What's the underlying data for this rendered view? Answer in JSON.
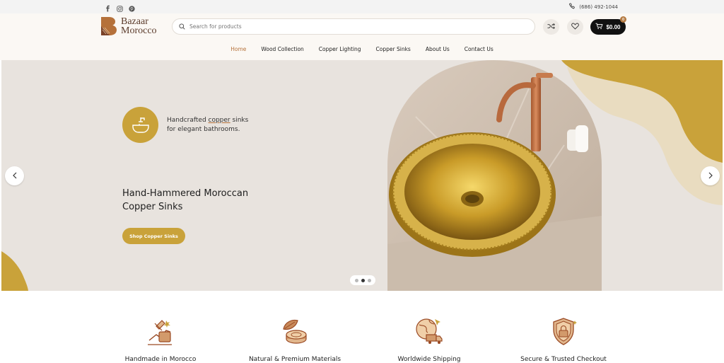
{
  "topbar": {
    "social": [
      "facebook-icon",
      "instagram-icon",
      "pinterest-icon"
    ],
    "phone": "(686) 492-1044"
  },
  "header": {
    "logo_line1": "Bazaar",
    "logo_line2": "Morocco",
    "search_placeholder": "Search for products",
    "cart_total": "$0.00",
    "cart_count": "0"
  },
  "nav": {
    "items": [
      "Home",
      "Wood Collection",
      "Copper Lighting",
      "Copper Sinks",
      "About Us",
      "Contact Us"
    ],
    "active": "Home"
  },
  "hero": {
    "badge_line1_pre": "Handcrafted ",
    "badge_line1_u": "copper",
    "badge_line1_post": " sinks",
    "badge_line2": "for elegant bathrooms.",
    "headline_line1": "Hand-Hammered Moroccan",
    "headline_line2": "Copper Sinks",
    "cta": "Shop Copper Sinks",
    "slide_active": 2,
    "slide_count": 3
  },
  "features": [
    {
      "label": "Handmade in Morocco",
      "icon": "handmade-icon"
    },
    {
      "label": "Natural & Premium Materials",
      "icon": "wood-log-icon"
    },
    {
      "label": "Worldwide Shipping",
      "icon": "shipping-globe-icon"
    },
    {
      "label": "Secure & Trusted Checkout",
      "icon": "shield-lock-icon"
    }
  ],
  "colors": {
    "accent_gold": "#c9a23a",
    "accent_copper": "#b5713a",
    "hero_bg": "#e8e3de",
    "header_bg": "#fbf8f4"
  }
}
